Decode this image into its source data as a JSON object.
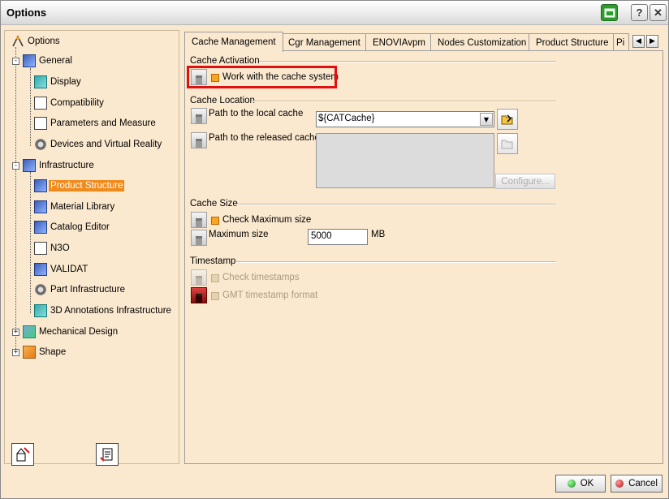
{
  "window": {
    "title": "Options",
    "controls": {
      "help": "?",
      "close": "✕"
    }
  },
  "tree": {
    "root": {
      "label": "Options",
      "icon": "options-tree-icon"
    },
    "items": [
      {
        "label": "General",
        "level": 1,
        "icon": "general-icon",
        "expander": "-"
      },
      {
        "label": "Display",
        "level": 2,
        "icon": "display-icon"
      },
      {
        "label": "Compatibility",
        "level": 2,
        "icon": "compatibility-icon"
      },
      {
        "label": "Parameters and Measure",
        "level": 2,
        "icon": "parameters-icon"
      },
      {
        "label": "Devices and Virtual Reality",
        "level": 2,
        "icon": "devices-icon"
      },
      {
        "label": "Infrastructure",
        "level": 1,
        "icon": "infrastructure-icon",
        "expander": "-"
      },
      {
        "label": "Product Structure",
        "level": 2,
        "icon": "product-structure-icon",
        "selected": true
      },
      {
        "label": "Material Library",
        "level": 2,
        "icon": "material-library-icon"
      },
      {
        "label": "Catalog Editor",
        "level": 2,
        "icon": "catalog-editor-icon"
      },
      {
        "label": "N3O",
        "level": 2,
        "icon": "n3o-icon"
      },
      {
        "label": "VALIDAT",
        "level": 2,
        "icon": "validat-icon"
      },
      {
        "label": "Part Infrastructure",
        "level": 2,
        "icon": "part-infrastructure-icon"
      },
      {
        "label": "3D Annotations Infrastructure",
        "level": 2,
        "icon": "annotations-icon"
      },
      {
        "label": "Mechanical Design",
        "level": 1,
        "icon": "mechanical-design-icon",
        "expander": "+"
      },
      {
        "label": "Shape",
        "level": 1,
        "icon": "shape-icon",
        "expander": "+"
      }
    ]
  },
  "tabs": [
    {
      "label": "Cache Management",
      "active": true
    },
    {
      "label": "Cgr Management"
    },
    {
      "label": "ENOVIAvpm"
    },
    {
      "label": "Nodes Customization"
    },
    {
      "label": "Product Structure"
    },
    {
      "label": "Pi"
    }
  ],
  "cache_activation": {
    "title": "Cache Activation",
    "work_with_cache": {
      "label": "Work with the cache system",
      "checked": true
    }
  },
  "cache_location": {
    "title": "Cache Location",
    "local_label": "Path to the local cache",
    "local_value": "${CATCache}",
    "released_label": "Path to the released cache",
    "configure_label": "Configure..."
  },
  "cache_size": {
    "title": "Cache Size",
    "check_max_label": "Check Maximum size",
    "max_label": "Maximum size",
    "max_value": "5000",
    "unit": "MB"
  },
  "timestamp": {
    "title": "Timestamp",
    "check_label": "Check timestamps",
    "gmt_label": "GMT timestamp format"
  },
  "footer": {
    "ok_label": "OK",
    "cancel_label": "Cancel"
  }
}
